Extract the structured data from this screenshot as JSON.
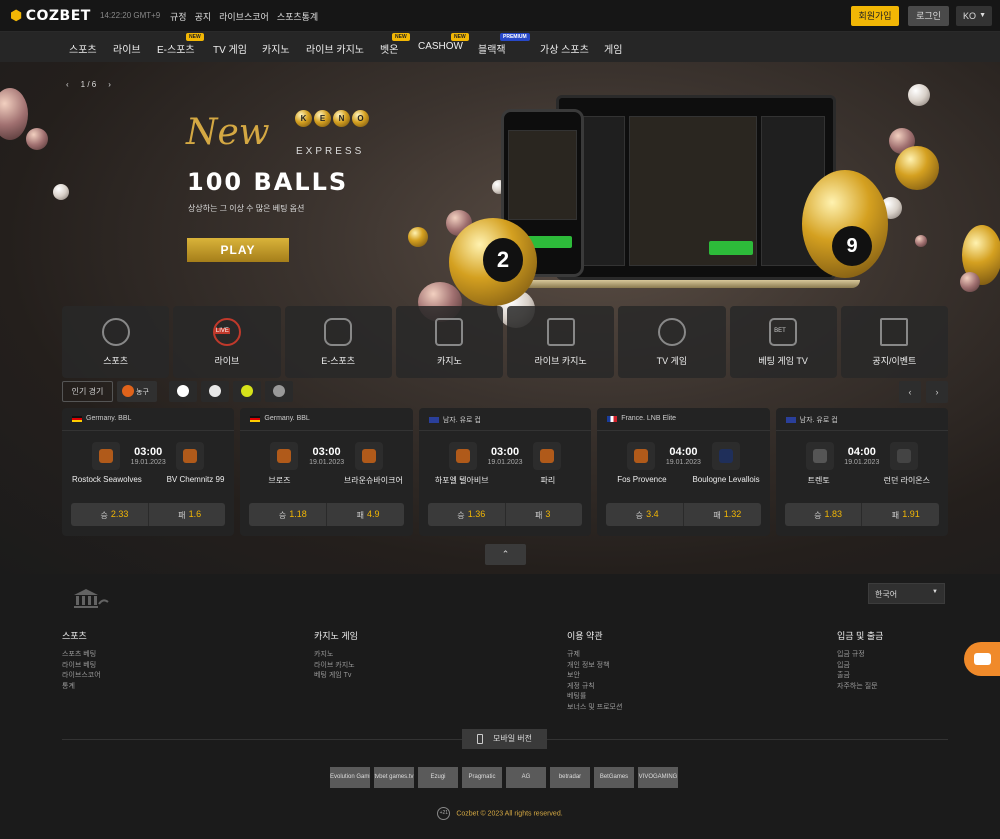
{
  "header": {
    "logo": "COZBET",
    "clock": "14:22:20  GMT+9",
    "links": [
      "규정",
      "공지",
      "라이브스코어",
      "스포츠통계"
    ],
    "join_label": "회원가입",
    "login_label": "로그인",
    "lang_label": "KO"
  },
  "nav": {
    "items": [
      {
        "label": "스포츠"
      },
      {
        "label": "라이브"
      },
      {
        "label": "E-스포츠",
        "badge": "NEW"
      },
      {
        "label": "TV 게임"
      },
      {
        "label": "카지노"
      },
      {
        "label": "라이브 카지노"
      },
      {
        "label": "벳온",
        "badge": "NEW"
      },
      {
        "label": "CASHOW",
        "badge": "NEW"
      },
      {
        "label": "블랙잭",
        "badge": "PREMIUM"
      },
      {
        "label": "가상 스포츠"
      },
      {
        "label": "게임"
      }
    ]
  },
  "hero": {
    "slide_counter": "1 / 6",
    "new_label": "New",
    "keno_letters": [
      "K",
      "E",
      "N",
      "O"
    ],
    "express_label": "EXPRESS",
    "title": "100 BALLS",
    "subtitle": "상상하는 그 이상 수 많은 베팅 옵션",
    "play_label": "PLAY",
    "ball_numbers": [
      "2",
      "9"
    ]
  },
  "categories": [
    {
      "label": "스포츠",
      "icon": "soccer-ball-icon"
    },
    {
      "label": "라이브",
      "icon": "live-icon",
      "badge": "LIVE"
    },
    {
      "label": "E-스포츠",
      "icon": "gamepad-icon"
    },
    {
      "label": "카지노",
      "icon": "slot-machine-icon"
    },
    {
      "label": "라이브 카지노",
      "icon": "cards-icon"
    },
    {
      "label": "TV 게임",
      "icon": "tv-game-icon"
    },
    {
      "label": "베팅 게임 TV",
      "icon": "bet-tv-icon",
      "badge": "BET"
    },
    {
      "label": "공지/이벤트",
      "icon": "gift-box-icon"
    }
  ],
  "sport_tabs": {
    "popular_label": "인기 경기",
    "active_label": "농구"
  },
  "matches": [
    {
      "league": "Germany. BBL",
      "time": "03:00",
      "date": "19.01.2023",
      "home": "Rostock Seawolves",
      "away": "BV Chemnitz 99",
      "odds": [
        {
          "label": "승",
          "value": "2.33"
        },
        {
          "label": "패",
          "value": "1.6"
        }
      ]
    },
    {
      "league": "Germany. BBL",
      "time": "03:00",
      "date": "19.01.2023",
      "home": "브로즈",
      "away": "브라운슈바이크어",
      "odds": [
        {
          "label": "승",
          "value": "1.18"
        },
        {
          "label": "패",
          "value": "4.9"
        }
      ]
    },
    {
      "league": "남자. 유로 컵",
      "time": "03:00",
      "date": "19.01.2023",
      "home": "하포엘 텔아비브",
      "away": "파리",
      "odds": [
        {
          "label": "승",
          "value": "1.36"
        },
        {
          "label": "패",
          "value": "3"
        }
      ]
    },
    {
      "league": "France. LNB Elite",
      "time": "04:00",
      "date": "19.01.2023",
      "home": "Fos Provence",
      "away": "Boulogne Levallois",
      "odds": [
        {
          "label": "승",
          "value": "3.4"
        },
        {
          "label": "패",
          "value": "1.32"
        }
      ]
    },
    {
      "league": "남자. 유로 컵",
      "time": "04:00",
      "date": "19.01.2023",
      "home": "트렌토",
      "away": "런던 라이온스",
      "odds": [
        {
          "label": "승",
          "value": "1.83"
        },
        {
          "label": "패",
          "value": "1.91"
        }
      ]
    }
  ],
  "footer": {
    "lang_select": "한국어",
    "columns": [
      {
        "title": "스포츠",
        "links": [
          "스포츠 베팅",
          "라이브 베팅",
          "라이브스코어",
          "통계"
        ]
      },
      {
        "title": "카지노 게임",
        "links": [
          "카지노",
          "라이브 카지노",
          "베팅 게임 Tv"
        ]
      },
      {
        "title": "이용 약관",
        "links": [
          "규제",
          "개인 정보 정책",
          "보안",
          "게정 규칙",
          "베팅률",
          "보너스 및 프로모션"
        ]
      },
      {
        "title": "입금 및 출금",
        "links": [
          "입금 규정",
          "입금",
          "출금",
          "자주하는 질문"
        ]
      }
    ],
    "mobile_label": "모바일 버전",
    "providers": [
      "Evolution Gaming",
      "tvbet games.tv",
      "Ezugi",
      "Pragmatic",
      "AG",
      "betradar",
      "BetGames",
      "VIVOGAMING"
    ],
    "age": "+21",
    "copyright": "Cozbet © 2023 All rights reserved."
  },
  "colors": {
    "accent": "#f2b705",
    "background": "#1b1b1b",
    "card": "#232323",
    "chat": "#f08a2a"
  }
}
